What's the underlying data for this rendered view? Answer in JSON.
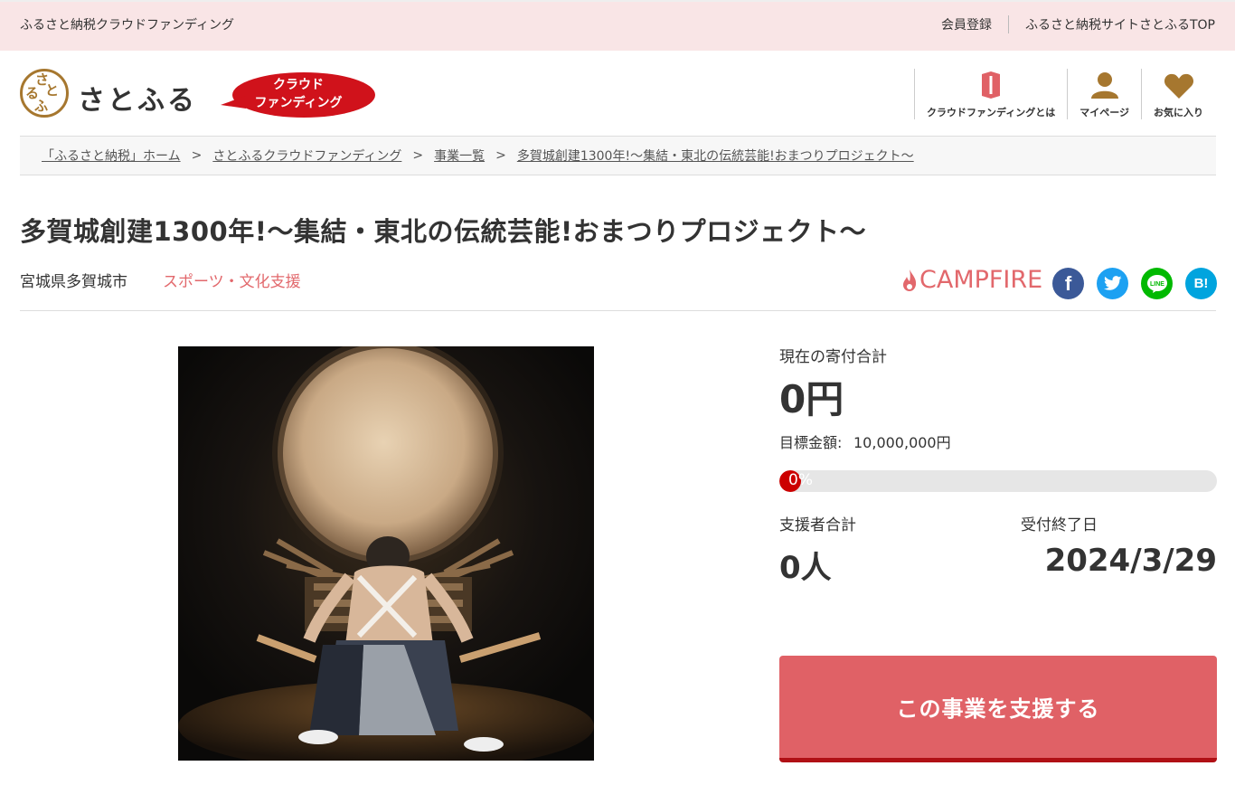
{
  "topbar": {
    "site_label": "ふるさと納税クラウドファンディング",
    "links": [
      "会員登録",
      "ふるさと納税サイトさとふるTOP"
    ]
  },
  "header": {
    "logo_name": "さとふる",
    "badge_line1": "クラウド",
    "badge_line2": "ファンディング",
    "nav": [
      {
        "label": "クラウドファンディングとは",
        "icon": "book-icon"
      },
      {
        "label": "マイページ",
        "icon": "person-icon"
      },
      {
        "label": "お気に入り",
        "icon": "heart-icon"
      }
    ]
  },
  "breadcrumb": [
    "「ふるさと納税」ホーム",
    "さとふるクラウドファンディング",
    "事業一覧",
    "多賀城創建1300年!〜集結・東北の伝統芸能!おまつりプロジェクト〜"
  ],
  "project": {
    "title": "多賀城創建1300年!〜集結・東北の伝統芸能!おまつりプロジェクト〜",
    "city": "宮城県多賀城市",
    "category": "スポーツ・文化支援",
    "platform": "CAMPFIRE"
  },
  "share": {
    "facebook": "f",
    "twitter": "twitter-bird-icon",
    "line": "LINE",
    "hatena": "B!"
  },
  "stats": {
    "total_label": "現在の寄付合計",
    "total_value": "0円",
    "goal_label": "目標金額:",
    "goal_value": "10,000,000円",
    "progress_text": "0%",
    "progress": 0,
    "supporters_label": "支援者合計",
    "supporters_value": "0人",
    "deadline_label": "受付終了日",
    "deadline_value": "2024/3/29"
  },
  "cta": {
    "label": "この事業を支援する"
  },
  "colors": {
    "topbar_bg": "#f9e5e6",
    "accent": "#e06166",
    "brand_brown": "#a6772f",
    "progress_fill": "#cc0000"
  }
}
